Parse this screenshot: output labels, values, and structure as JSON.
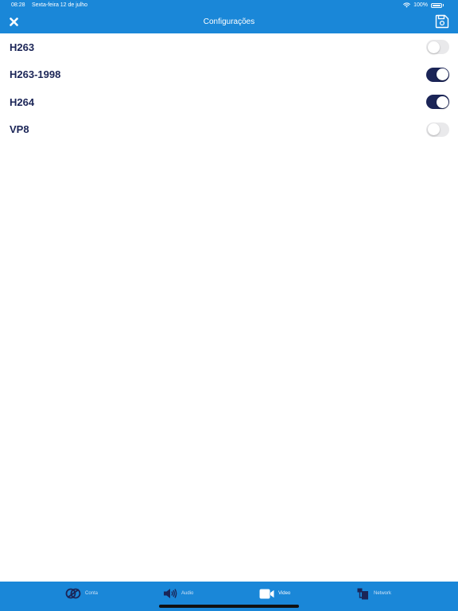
{
  "status_bar": {
    "time": "08:28",
    "date": "Sexta-feira 12 de julho",
    "battery": "100%"
  },
  "header": {
    "title": "Configurações",
    "close_icon": "close-icon",
    "save_icon": "save-icon"
  },
  "codecs": [
    {
      "label": "H263",
      "enabled": false
    },
    {
      "label": "H263-1998",
      "enabled": true
    },
    {
      "label": "H264",
      "enabled": true
    },
    {
      "label": "VP8",
      "enabled": false
    }
  ],
  "tabs": [
    {
      "label": "Conta",
      "icon": "account-icon",
      "active": false
    },
    {
      "label": "Audio",
      "icon": "speaker-icon",
      "active": false
    },
    {
      "label": "Video",
      "icon": "video-camera-icon",
      "active": true
    },
    {
      "label": "Network",
      "icon": "network-icon",
      "active": false
    }
  ],
  "colors": {
    "accent": "#1a87d8",
    "toggle_on": "#1b2557",
    "toggle_off": "#e9e9eb",
    "text": "#1b2557"
  }
}
